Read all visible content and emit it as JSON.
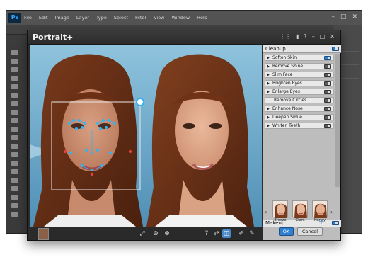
{
  "host": {
    "logo": "Ps",
    "menu": [
      "File",
      "Edit",
      "Image",
      "Layer",
      "Type",
      "Select",
      "Filter",
      "View",
      "Window",
      "Help"
    ],
    "window_controls": [
      "minimize-icon",
      "maximize-icon",
      "close-icon"
    ]
  },
  "dialog": {
    "title": "Portrait+",
    "title_icons": [
      "grid-icon",
      "chat-icon",
      "help-icon",
      "minimize-icon",
      "maximize-icon",
      "close-icon"
    ]
  },
  "panel": {
    "cleanup_title": "Cleanup",
    "cleanup_items": [
      {
        "label": "Soften Skin",
        "arrow": true,
        "on": true
      },
      {
        "label": "Remove Shine",
        "arrow": true,
        "on": false
      },
      {
        "label": "Slim Face",
        "arrow": true,
        "on": false
      },
      {
        "label": "Brighten Eyes",
        "arrow": true,
        "on": false
      },
      {
        "label": "Enlarge Eyes",
        "arrow": true,
        "on": false
      },
      {
        "label": "Remove Circles",
        "arrow": false,
        "on": false
      },
      {
        "label": "Enhance Nose",
        "arrow": true,
        "on": false
      },
      {
        "label": "Deepen Smile",
        "arrow": true,
        "on": false
      },
      {
        "label": "Whiten Teeth",
        "arrow": true,
        "on": false
      }
    ],
    "makeup_title": "Makeup",
    "makeup_styles": [
      "Breeze",
      "Glam",
      "Honey"
    ]
  },
  "buttons": {
    "ok": "OK",
    "cancel": "Cancel"
  },
  "colors": {
    "accent": "#2f7fd0",
    "marker_blue": "#36b2ef",
    "marker_red": "#e0443a"
  }
}
